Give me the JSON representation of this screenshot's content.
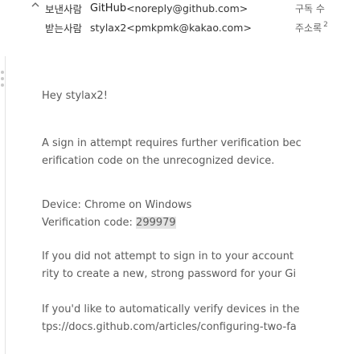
{
  "header": {
    "sender_label": "보낸사람",
    "sender_name": "GitHub",
    "sender_email": "<noreply@github.com>",
    "sender_right": "구독 수",
    "recipient_label": "받는사람",
    "recipient_value": "stylax2<pmkpmk@kakao.com>",
    "recipient_right": "주소록",
    "recipient_right_small": "2"
  },
  "body": {
    "greeting": "Hey stylax2!",
    "para1_line1": "A sign in attempt requires further verification bec",
    "para1_line2": "erification code on the unrecognized device.",
    "device_line": "Device: Chrome on Windows",
    "code_prefix": "Verification code: ",
    "code_value": "299979",
    "para3_line1": "If you did not attempt to sign in to your account",
    "para3_line2": "rity to create a new, strong password for your Gi",
    "para4_line1": "If you'd like to automatically verify devices in the",
    "para4_line2": "tps://docs.github.com/articles/configuring-two-fa"
  }
}
